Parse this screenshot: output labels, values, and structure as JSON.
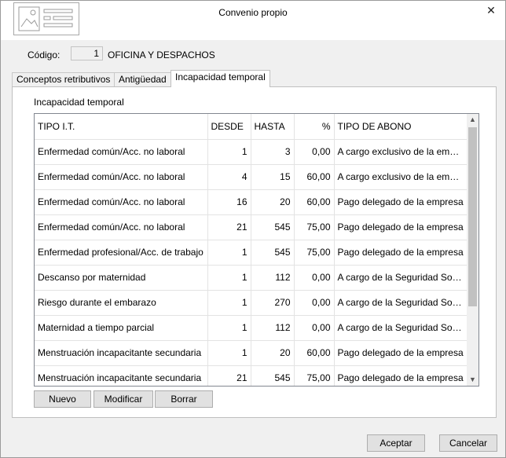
{
  "window": {
    "title": "Convenio propio",
    "close_glyph": "✕",
    "app_icon": "image-document-icon"
  },
  "codigo": {
    "label": "Código:",
    "value": "1",
    "name": "OFICINA Y DESPACHOS"
  },
  "tabs": [
    {
      "label": "Conceptos retributivos"
    },
    {
      "label": "Antigüedad"
    },
    {
      "label": "Incapacidad temporal",
      "active": true
    }
  ],
  "section": {
    "label": "Incapacidad temporal"
  },
  "table": {
    "headers": [
      "TIPO I.T.",
      "DESDE",
      "HASTA",
      "%",
      "TIPO DE ABONO"
    ],
    "rows": [
      [
        "Enfermedad común/Acc. no laboral",
        "1",
        "3",
        "0,00",
        "A cargo exclusivo de la empresa"
      ],
      [
        "Enfermedad común/Acc. no laboral",
        "4",
        "15",
        "60,00",
        "A cargo exclusivo de la empresa"
      ],
      [
        "Enfermedad común/Acc. no laboral",
        "16",
        "20",
        "60,00",
        "Pago delegado de la empresa"
      ],
      [
        "Enfermedad común/Acc. no laboral",
        "21",
        "545",
        "75,00",
        "Pago delegado de la empresa"
      ],
      [
        "Enfermedad profesional/Acc. de trabajo",
        "1",
        "545",
        "75,00",
        "Pago delegado de la empresa"
      ],
      [
        "Descanso por maternidad",
        "1",
        "112",
        "0,00",
        "A cargo de la Seguridad Social"
      ],
      [
        "Riesgo durante el embarazo",
        "1",
        "270",
        "0,00",
        "A cargo de la Seguridad Social"
      ],
      [
        "Maternidad a tiempo parcial",
        "1",
        "112",
        "0,00",
        "A cargo de la Seguridad Social"
      ],
      [
        "Menstruación incapacitante secundaria",
        "1",
        "20",
        "60,00",
        "Pago delegado de la empresa"
      ],
      [
        "Menstruación incapacitante secundaria",
        "21",
        "545",
        "75,00",
        "Pago delegado de la empresa"
      ]
    ]
  },
  "buttons": {
    "nuevo": "Nuevo",
    "modificar": "Modificar",
    "borrar": "Borrar",
    "aceptar": "Aceptar",
    "cancelar": "Cancelar"
  },
  "scrollbar": {
    "up": "▲",
    "down": "▼"
  }
}
